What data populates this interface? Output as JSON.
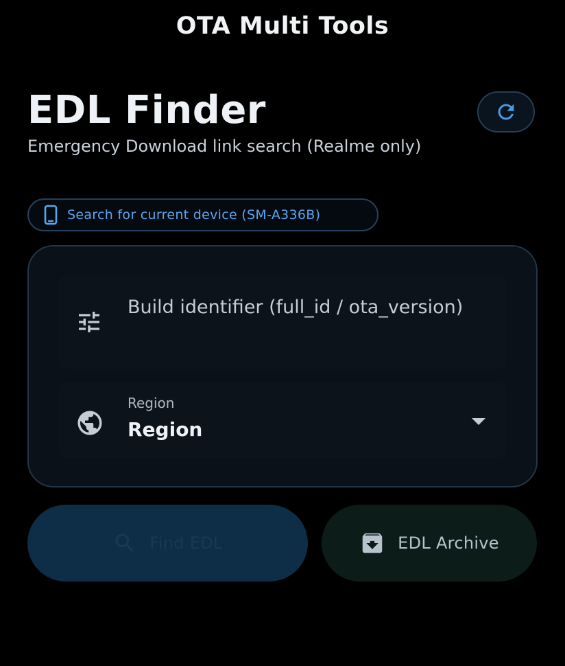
{
  "header": {
    "app_title": "OTA Multi Tools"
  },
  "page": {
    "title": "EDL Finder",
    "subtitle": "Emergency Download link search (Realme only)"
  },
  "device_chip": {
    "label": "Search for current device (SM-A336B)",
    "icon": "smartphone-icon"
  },
  "form": {
    "build_field": {
      "placeholder": "Build identifier (full_id / ota_version)",
      "icon": "tune-sliders-icon"
    },
    "region_field": {
      "label": "Region",
      "value": "Region",
      "icon": "globe-icon"
    }
  },
  "actions": {
    "find_label": "Find EDL",
    "archive_label": "EDL Archive"
  },
  "colors": {
    "accent_blue": "#58a6f0",
    "background": "#000000",
    "card": "#0b1118",
    "find_button_bg": "#0e2d46",
    "archive_button_bg": "#0c1d19"
  }
}
